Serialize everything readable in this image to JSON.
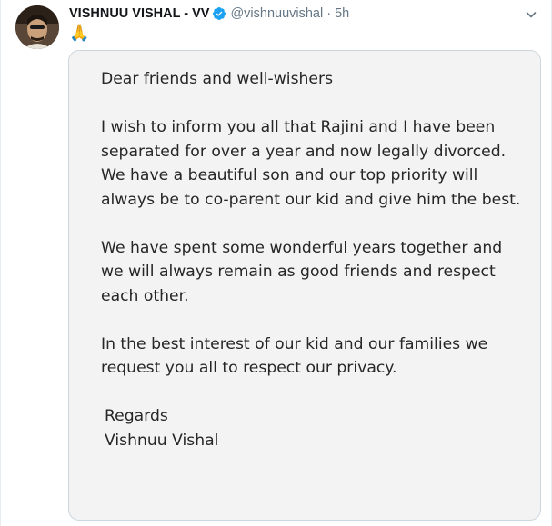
{
  "author": {
    "display_name": "VISHNUU VISHAL - VV",
    "handle": "@vishnuuvishal",
    "separator": "·",
    "timestamp": "5h"
  },
  "tweet": {
    "text": "🙏"
  },
  "letter": {
    "greeting": "Dear friends and well-wishers",
    "paragraph_1": "I wish to inform you all that Rajini and I have been separated for over a year and now legally divorced. We have a beautiful son and our top priority will always be to co-parent our kid and give him the best.",
    "paragraph_2": "We have spent some wonderful years together and we will always remain as good friends and respect each other.",
    "paragraph_3": "In the best interest of our kid and our families we request you all to respect our privacy.",
    "closing": "Regards",
    "signature": "Vishnuu Vishal"
  },
  "icons": {
    "verified": "verified-badge-icon",
    "caret": "chevron-down-icon"
  },
  "colors": {
    "verified": "#1da1f2",
    "secondary_text": "#657786",
    "media_background": "#f3f3f3"
  }
}
